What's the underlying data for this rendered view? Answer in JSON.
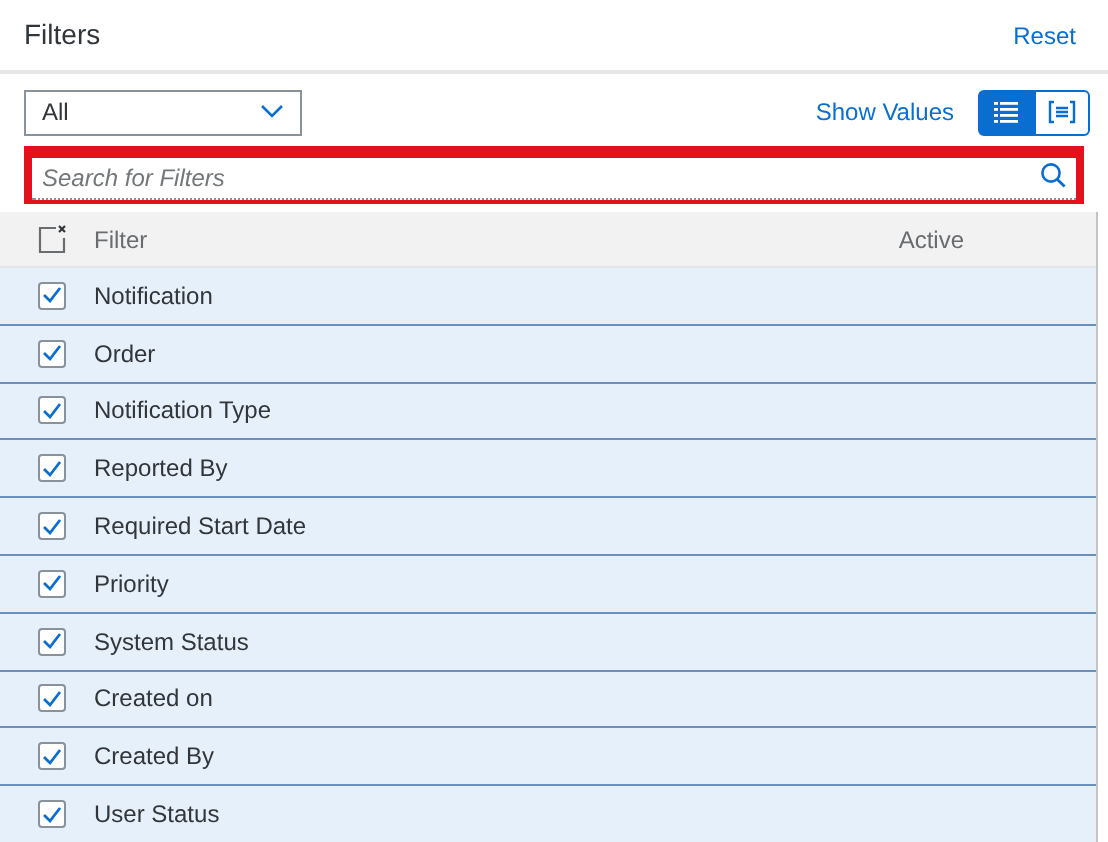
{
  "header": {
    "title": "Filters",
    "reset": "Reset"
  },
  "toolbar": {
    "dropdown": {
      "value": "All"
    },
    "show_values": "Show Values",
    "view_toggle": [
      {
        "kind": "list",
        "selected": true
      },
      {
        "kind": "detail",
        "selected": false
      }
    ]
  },
  "search": {
    "placeholder": "Search for Filters",
    "highlighted": true
  },
  "table": {
    "columns": [
      "Filter",
      "Active"
    ],
    "rows": [
      {
        "label": "Notification",
        "checked": true,
        "selected": true
      },
      {
        "label": "Order",
        "checked": true,
        "selected": true
      },
      {
        "label": "Notification Type",
        "checked": true,
        "selected": true
      },
      {
        "label": "Reported By",
        "checked": true,
        "selected": true
      },
      {
        "label": "Required Start Date",
        "checked": true,
        "selected": true
      },
      {
        "label": "Priority",
        "checked": true,
        "selected": true
      },
      {
        "label": "System Status",
        "checked": true,
        "selected": true
      },
      {
        "label": "Created on",
        "checked": true,
        "selected": true
      },
      {
        "label": "Created By",
        "checked": true,
        "selected": true
      },
      {
        "label": "User Status",
        "checked": true,
        "selected": true
      }
    ]
  }
}
